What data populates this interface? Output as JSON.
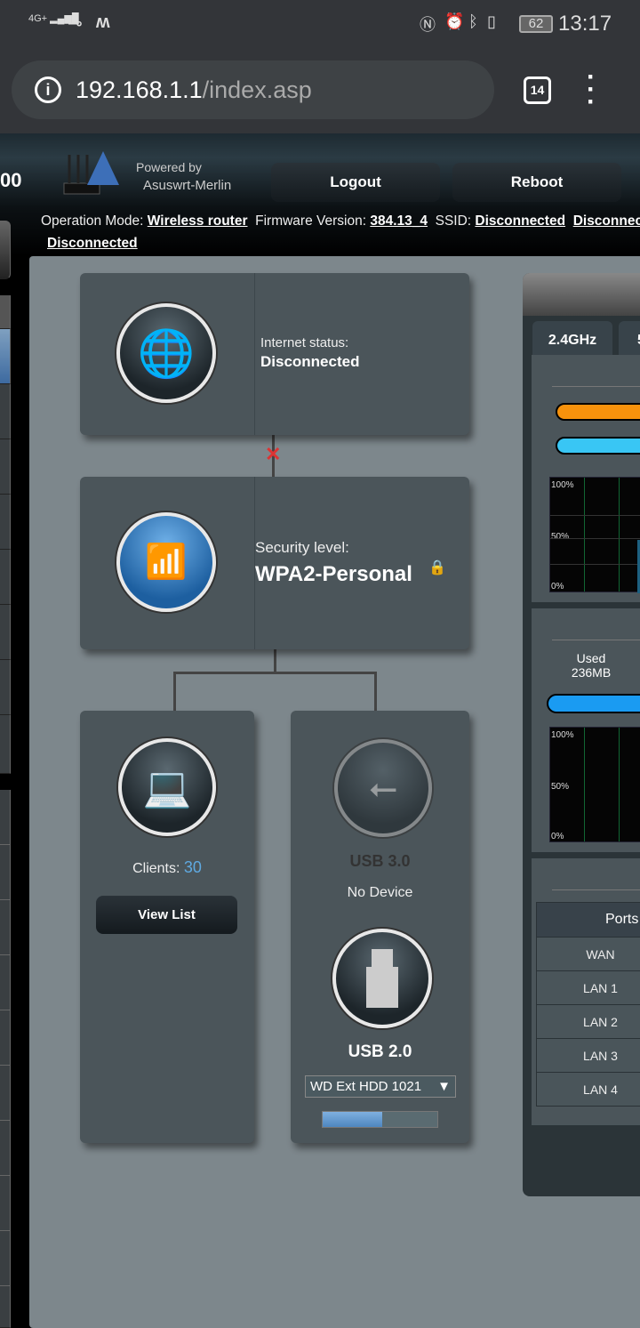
{
  "status_bar": {
    "network": "4G+",
    "time": "13:17",
    "battery": "62",
    "icons": [
      "signal-icon",
      "vpn-key-icon",
      "m-icon",
      "nfc-icon",
      "alarm-icon",
      "bluetooth-icon",
      "vibrate-icon",
      "battery-icon"
    ]
  },
  "browser": {
    "url_host": "192.168.1.1",
    "url_path": "/index.asp",
    "tab_count": "14"
  },
  "header": {
    "model_suffix": "00",
    "powered_by": "Powered by",
    "brand": "Asuswrt-Merlin",
    "logout": "Logout",
    "reboot": "Reboot",
    "op_mode_label": "Operation Mode:",
    "op_mode": "Wireless router",
    "fw_label": "Firmware Version:",
    "fw": "384.13_4",
    "ssid_label": "SSID:",
    "ssid1": "Disconnected",
    "ssid2": "Disconnected",
    "ssid3": "Disconnected"
  },
  "internet": {
    "label": "Internet status:",
    "value": "Disconnected"
  },
  "router": {
    "label": "Security level:",
    "value": "WPA2-Personal"
  },
  "clients": {
    "label": "Clients:",
    "count": "30",
    "view_list": "View List"
  },
  "usb3": {
    "label": "USB 3.0",
    "status": "No Device"
  },
  "usb2": {
    "label": "USB 2.0",
    "device": "WD Ext HDD 1021",
    "usage_fraction": 0.52
  },
  "system": {
    "tab_24": "2.4GHz",
    "tab_5": "5",
    "colors": {
      "cpu1": "#f7920c",
      "cpu2": "#39c6f4",
      "ram": "#1a9bf2"
    },
    "graph_ticks": [
      "100%",
      "50%",
      "0%"
    ],
    "ram_used_label": "Used",
    "ram_used": "236MB",
    "ports_header": "Ports",
    "ports": [
      "WAN",
      "LAN 1",
      "LAN 2",
      "LAN 3",
      "LAN 4"
    ]
  }
}
